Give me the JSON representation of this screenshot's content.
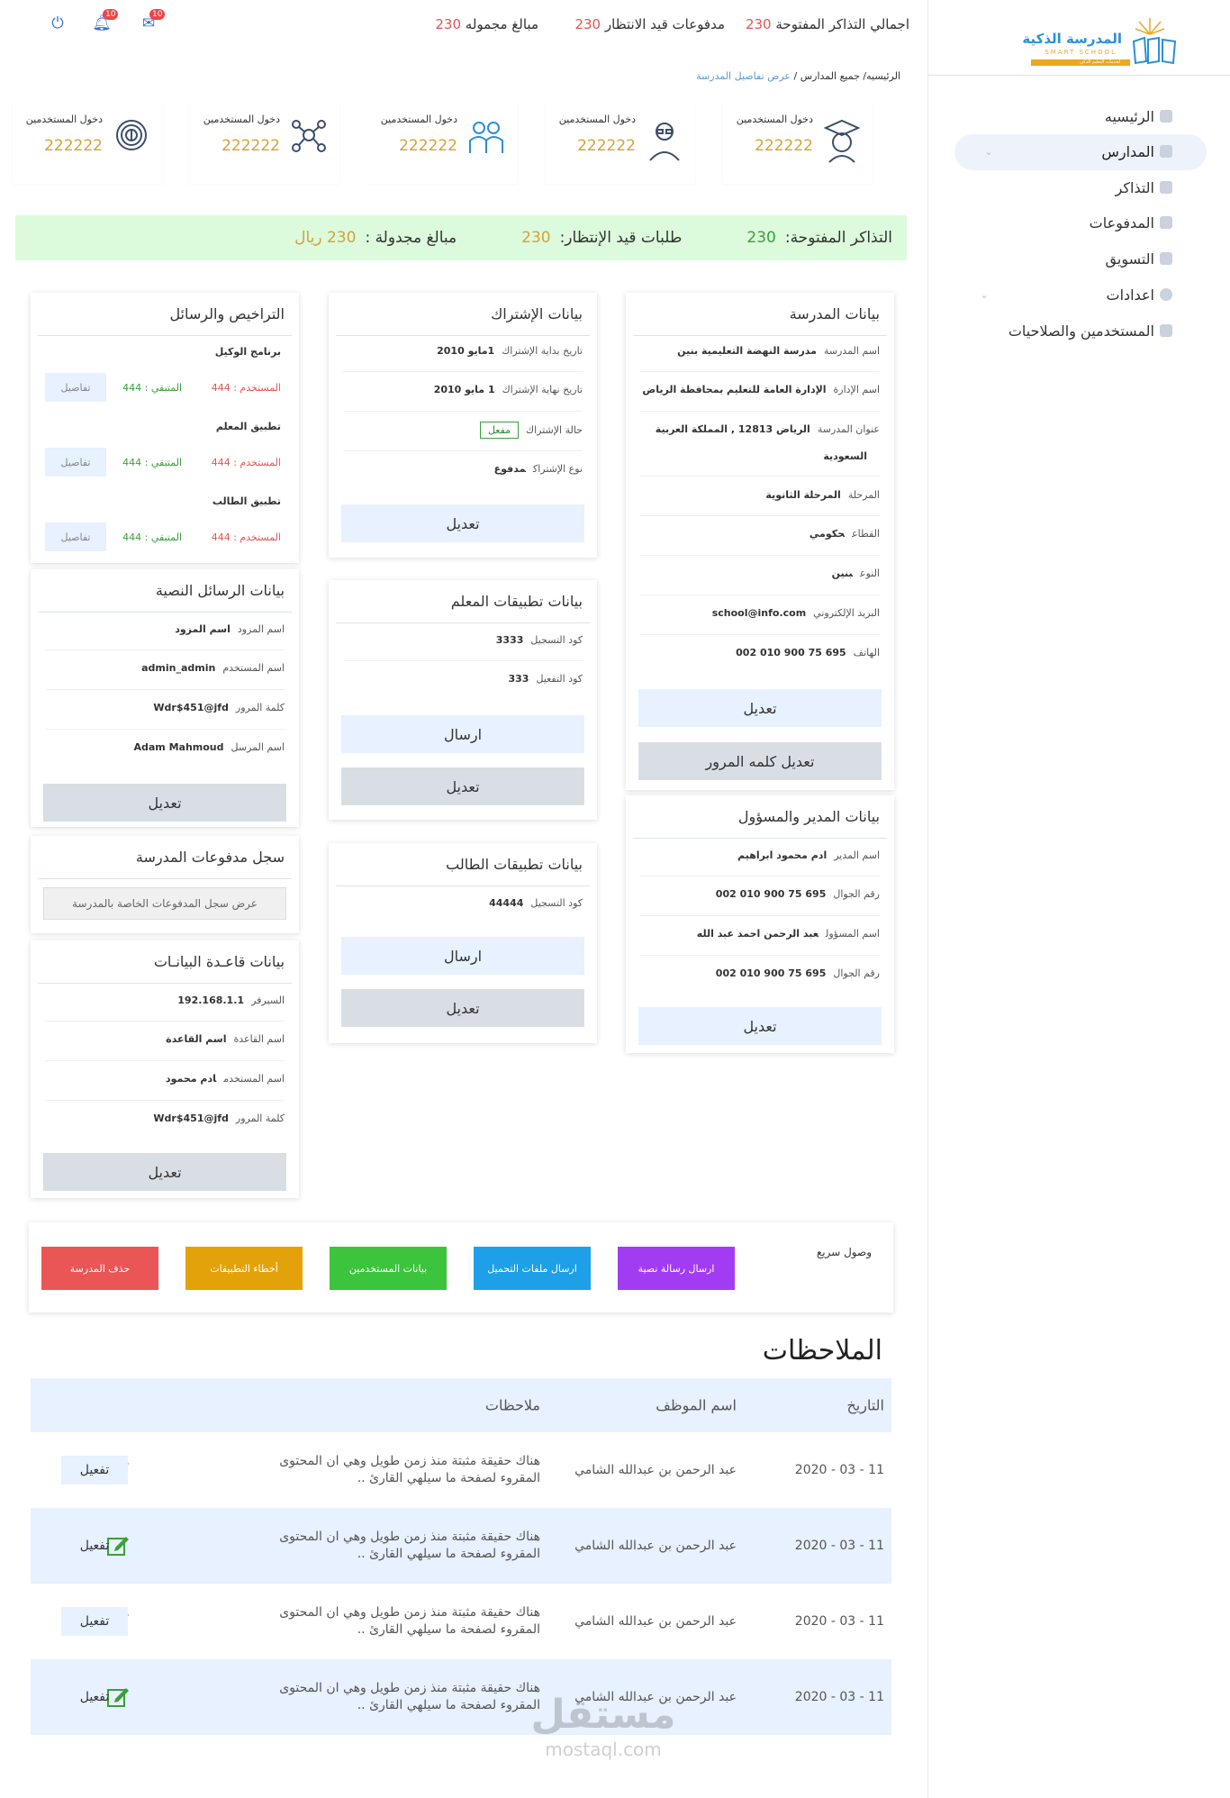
{
  "brand": {
    "logo_ar": "المدرسة الذكية",
    "logo_en": "SMART SCHOOL",
    "tagline": "لخدمات التعليم الذكي"
  },
  "sidebar": {
    "items": [
      {
        "label": "الرئيسيه",
        "icon": "dashboard-icon"
      },
      {
        "label": "المدارس",
        "icon": "users-icon"
      },
      {
        "label": "التذاكر",
        "icon": "archive-icon"
      },
      {
        "label": "المدفوعات",
        "icon": "card-icon"
      },
      {
        "label": "التسويق",
        "icon": "megaphone-icon"
      },
      {
        "label": "اعدادات",
        "icon": "gear-icon"
      },
      {
        "label": "المستخدمين والصلاحيات",
        "icon": "folder-icon"
      }
    ]
  },
  "topbar": {
    "open_tickets_label": "اجمالي التذاكر المفتوحة",
    "open_tickets_value": "230",
    "pending_payments_label": "مدفوعات قيد الانتظار",
    "pending_payments_value": "230",
    "total_amount_label": "مبالغ مجموله",
    "total_amount_value": "230",
    "mail_badge": "10",
    "bell_badge": "10"
  },
  "breadcrumb": {
    "home": "الرئيسيه/",
    "schools": "جميع المدارس",
    "sep": "/",
    "current": "عرض تفاصيل المدرسة"
  },
  "stats": [
    {
      "label": "دخول المستخدمين",
      "value": "222222",
      "icon": "graduate-icon"
    },
    {
      "label": "دخول المستخدمين",
      "value": "222222",
      "icon": "teacher-icon"
    },
    {
      "label": "دخول المستخدمين",
      "value": "222222",
      "icon": "family-icon"
    },
    {
      "label": "دخول المستخدمين",
      "value": "222222",
      "icon": "network-icon"
    },
    {
      "label": "دخول المستخدمين",
      "value": "222222",
      "icon": "fingerprint-icon"
    }
  ],
  "summary": {
    "open_label": "التذاكر المفتوحة:",
    "open_value": "230",
    "pending_label": "طلبات قيد الإنتظار:",
    "pending_value": "230",
    "amount_label": "مبالغ مجدولة :",
    "amount_value": "230 ريال"
  },
  "school": {
    "title": "بيانات المدرسة",
    "rows": [
      {
        "k": "اسم المدرسة",
        "v": "مدرسة النهضة التعليمية بنين"
      },
      {
        "k": "اسم الإدارة",
        "v": "الإدارة العامة للتعليم بمحافظة الرياض"
      },
      {
        "k": "عنوان المدرسة",
        "v": "الرياض 12813 , المملكة العربية",
        "v2": "السعودية"
      },
      {
        "k": "المرحلة",
        "v": "المرحلة الثانوية"
      },
      {
        "k": "القطاع",
        "v": "حكومي"
      },
      {
        "k": "النوع",
        "v": "بنين"
      },
      {
        "k": "البريد الإلكتروني",
        "v": "school@info.com"
      },
      {
        "k": "الهاتف",
        "v": "695 75 900 010 002"
      }
    ],
    "edit": "تعديل",
    "edit_password": "تعديل كلمه المرور"
  },
  "manager": {
    "title": "بيانات المدير والمسؤول",
    "rows": [
      {
        "k": "اسم المدير",
        "v": "ادم محمود ابراهيم"
      },
      {
        "k": "رقم الجوال",
        "v": "695 75 900 010 002"
      },
      {
        "k": "اسم المسؤول",
        "v": "عبد الرحمن احمد عبد الله"
      },
      {
        "k": "رقم الجوال",
        "v": "695 75 900 010 002"
      }
    ],
    "edit": "تعديل"
  },
  "subscription": {
    "title": "بيانات الإشتراك",
    "rows": [
      {
        "k": "تاريخ بداية الإشتراك",
        "v": "1مايو 2010"
      },
      {
        "k": "تاريخ نهاية الإشتراك",
        "v": "1 مايو 2010"
      },
      {
        "k": "حالة الإشتراك",
        "v": "مفعل"
      },
      {
        "k": "نوع الإشتراك",
        "v": "مدفوع"
      }
    ],
    "edit": "تعديل"
  },
  "teacher_apps": {
    "title": "بيانات تطبيقات المعلم",
    "rows": [
      {
        "k": "كود التسجيل",
        "v": "3333"
      },
      {
        "k": "كود التفعيل",
        "v": "333"
      }
    ],
    "send": "ارسال",
    "edit": "تعديل"
  },
  "student_apps": {
    "title": "بيانات تطبيقات الطالب",
    "rows": [
      {
        "k": "كود التسجيل",
        "v": "44444"
      }
    ],
    "send": "ارسال",
    "edit": "تعديل"
  },
  "licenses": {
    "title": "التراخيص والرسائل",
    "items": [
      {
        "name": "برنامج الوكيل",
        "used": "المستخدم : 444",
        "rest": "المتبقي : 444",
        "details": "تفاصيل"
      },
      {
        "name": "تطبيق المعلم",
        "used": "المستخدم : 444",
        "rest": "المتبقي : 444",
        "details": "تفاصيل"
      },
      {
        "name": "تطبيق الطالب",
        "used": "المستخدم : 444",
        "rest": "المتبقي : 444",
        "details": "تفاصيل"
      }
    ]
  },
  "sms": {
    "title": "بيانات الرسائل النصية",
    "rows": [
      {
        "k": "اسم المزود",
        "v": "اسم المزود"
      },
      {
        "k": "اسم المستخدم",
        "v": "admin_admin"
      },
      {
        "k": "كلمة المرور",
        "v": "Wdr$451@jfd"
      },
      {
        "k": "اسم المرسل",
        "v": "Adam Mahmoud"
      }
    ],
    "edit": "تعديل"
  },
  "payments_log": {
    "title": "سجل مدفوعات المدرسة",
    "button": "عرض سجل المدفوعات الخاصة بالمدرسة"
  },
  "database": {
    "title": "بيانات قاعـدة البيانـات",
    "rows": [
      {
        "k": "السيرفر",
        "v": "192.168.1.1"
      },
      {
        "k": "اسم القاعدة",
        "v": "اسم القاعدة"
      },
      {
        "k": "اسم المستخدم",
        "v": "ادم محمود"
      },
      {
        "k": "كلمة المرور",
        "v": "Wdr$451@jfd"
      }
    ],
    "edit": "تعديل"
  },
  "quick_access": {
    "label": "وصول سريع",
    "buttons": [
      {
        "label": "ارسال رسالة نصية",
        "color": "#a23cf2"
      },
      {
        "label": "ارسال ملفات التحميل",
        "color": "#1ea0e8"
      },
      {
        "label": "بيانات المستخدمين",
        "color": "#3cc43c"
      },
      {
        "label": "أخطاء التطبيقات",
        "color": "#e4a20a"
      },
      {
        "label": "حذف المدرسة",
        "color": "#ea5656"
      }
    ]
  },
  "notes": {
    "title": "الملاحظات",
    "columns": {
      "date": "التاريخ",
      "employee": "اسم الموظف",
      "note": "ملاحظات"
    },
    "rows": [
      {
        "date": "11 - 03 - 2020",
        "employee": "عبد الرحمن بن عبدالله الشامي",
        "note": "هناك حقيقة مثبتة منذ زمن طويل وهي ان المحتوى المقروء لصفحة ما سيلهي القارئ ..",
        "action": "تفعيل"
      },
      {
        "date": "11 - 03 - 2020",
        "employee": "عبد الرحمن بن عبدالله الشامي",
        "note": "هناك حقيقة مثبتة منذ زمن طويل وهي ان المحتوى المقروء لصفحة ما سيلهي القارئ ..",
        "action": "تفعيل"
      },
      {
        "date": "11 - 03 - 2020",
        "employee": "عبد الرحمن بن عبدالله الشامي",
        "note": "هناك حقيقة مثبتة منذ زمن طويل وهي ان المحتوى المقروء لصفحة ما سيلهي القارئ ..",
        "action": "تفعيل"
      },
      {
        "date": "11 - 03 - 2020",
        "employee": "عبد الرحمن بن عبدالله الشامي",
        "note": "هناك حقيقة مثبتة منذ زمن طويل وهي ان المحتوى المقروء لصفحة ما سيلهي القارئ ..",
        "action": "تفعيل"
      }
    ]
  },
  "watermark": {
    "ar": "مستقل",
    "en": "mostaql.com"
  },
  "colors": {
    "accent_blue": "#e7f1ff",
    "gold": "#d6a13a",
    "red": "#e55353",
    "green_bg": "#dcfadc"
  }
}
